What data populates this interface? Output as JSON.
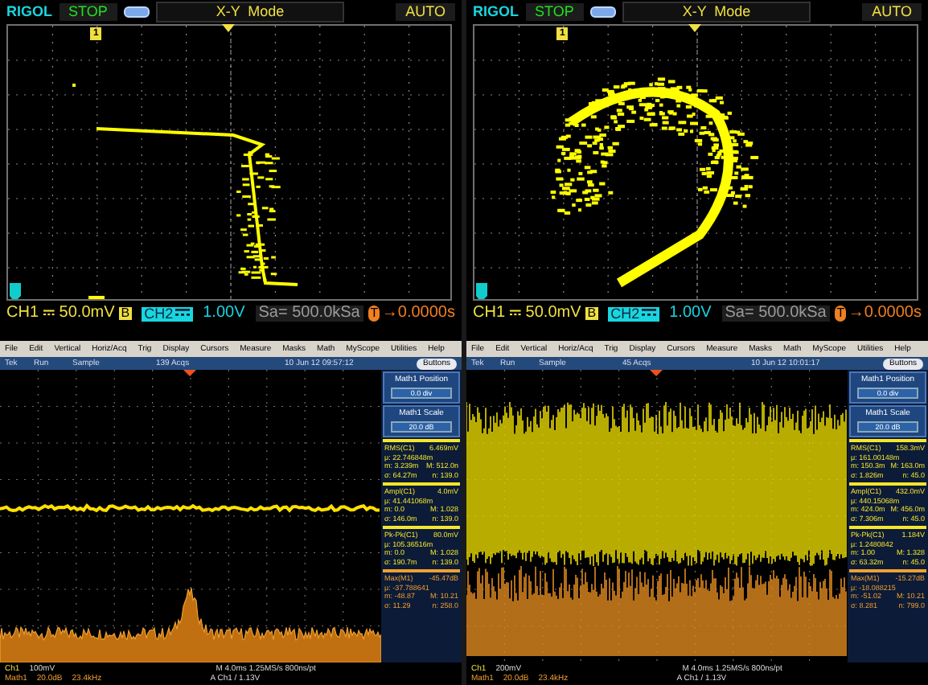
{
  "xy_scopes": [
    {
      "brand": "RIGOL",
      "run_state": "STOP",
      "mode": "X-Y  Mode",
      "trigger_mode": "AUTO",
      "trigger_marker": "1",
      "ch1": {
        "label": "CH1",
        "scale": "50.0mV",
        "badge": "B"
      },
      "ch2": {
        "label": "CH2",
        "scale": "1.00V"
      },
      "sample_rate": "Sa= 500.0kSa",
      "trigger_icon": "T",
      "trigger_offset": "→0.0000s",
      "kind": "trace"
    },
    {
      "brand": "RIGOL",
      "run_state": "STOP",
      "mode": "X-Y  Mode",
      "trigger_mode": "AUTO",
      "trigger_marker": "1",
      "ch1": {
        "label": "CH1",
        "scale": "50.0mV",
        "badge": "B"
      },
      "ch2": {
        "label": "CH2",
        "scale": "1.00V"
      },
      "sample_rate": "Sa= 500.0kSa",
      "trigger_icon": "T",
      "trigger_offset": "→0.0000s",
      "kind": "cloud"
    }
  ],
  "tek_scopes": [
    {
      "menu": [
        "File",
        "Edit",
        "Vertical",
        "Horiz/Acq",
        "Trig",
        "Display",
        "Cursors",
        "Measure",
        "Masks",
        "Math",
        "MyScope",
        "Utilities",
        "Help"
      ],
      "status": [
        "Tek",
        "Run",
        "Sample",
        "139 Acqs",
        "10 Jun 12 09:57:12"
      ],
      "buttons_label": "Buttons",
      "side_buttons": [
        {
          "title": "Math1 Position",
          "value": "0.0 div"
        },
        {
          "title": "Math1 Scale",
          "value": "20.0 dB"
        }
      ],
      "measurements": [
        {
          "name": "RMS(C1)",
          "value": "6.469mV",
          "color": "#f5e62a",
          "rows": [
            [
              "μ: 22.746848m"
            ],
            [
              "m: 3.239m",
              "M: 512.0n"
            ],
            [
              "σ: 64.27m",
              "n: 139.0"
            ]
          ]
        },
        {
          "name": "Ampl(C1)",
          "value": "4.0mV",
          "color": "#f5e62a",
          "rows": [
            [
              "μ: 41.441068m"
            ],
            [
              "m: 0.0",
              "M: 1.028"
            ],
            [
              "σ: 146.0m",
              "n: 139.0"
            ]
          ]
        },
        {
          "name": "Pk-Pk(C1)",
          "value": "80.0mV",
          "color": "#f5e62a",
          "rows": [
            [
              "μ: 105.36516m"
            ],
            [
              "m: 0.0",
              "M: 1.028"
            ],
            [
              "σ: 190.7m",
              "n: 139.0"
            ]
          ]
        },
        {
          "name": "Max(M1)",
          "value": "-45.47dB",
          "color": "#f0a030",
          "rows": [
            [
              "μ: -37.788641"
            ],
            [
              "m: -48.87",
              "M: 10.21"
            ],
            [
              "σ: 11.29",
              "n: 258.0"
            ]
          ]
        }
      ],
      "footer": {
        "ch": "Ch1",
        "ch_scale": "100mV",
        "timebase": "M 4.0ms 1.25MS/s 800ns/pt",
        "trigger": "A Ch1 / 1.13V",
        "math": "Math1",
        "math_scale": "20.0dB",
        "math_span": "23.4kHz"
      },
      "kind": "quiet"
    },
    {
      "menu": [
        "File",
        "Edit",
        "Vertical",
        "Horiz/Acq",
        "Trig",
        "Display",
        "Cursors",
        "Measure",
        "Masks",
        "Math",
        "MyScope",
        "Utilities",
        "Help"
      ],
      "status": [
        "Tek",
        "Run",
        "Sample",
        "45 Acqs",
        "10 Jun 12 10:01:17"
      ],
      "buttons_label": "Buttons",
      "side_buttons": [
        {
          "title": "Math1 Position",
          "value": "0.0 div"
        },
        {
          "title": "Math1 Scale",
          "value": "20.0 dB"
        }
      ],
      "measurements": [
        {
          "name": "RMS(C1)",
          "value": "158.3mV",
          "color": "#f5e62a",
          "rows": [
            [
              "μ: 161.00148m"
            ],
            [
              "m: 150.3m",
              "M: 163.0m"
            ],
            [
              "σ: 1.826m",
              "n: 45.0"
            ]
          ]
        },
        {
          "name": "Ampl(C1)",
          "value": "432.0mV",
          "color": "#f5e62a",
          "rows": [
            [
              "μ: 440.15068m"
            ],
            [
              "m: 424.0m",
              "M: 456.0m"
            ],
            [
              "σ: 7.306m",
              "n: 45.0"
            ]
          ]
        },
        {
          "name": "Pk-Pk(C1)",
          "value": "1.184V",
          "color": "#f5e62a",
          "rows": [
            [
              "μ: 1.2480842"
            ],
            [
              "m: 1.00",
              "M: 1.328"
            ],
            [
              "σ: 63.32m",
              "n: 45.0"
            ]
          ]
        },
        {
          "name": "Max(M1)",
          "value": "-15.27dB",
          "color": "#f0a030",
          "rows": [
            [
              "μ: -18.088215"
            ],
            [
              "m: -51.02",
              "M: 10.21"
            ],
            [
              "σ: 8.281",
              "n: 799.0"
            ]
          ]
        }
      ],
      "footer": {
        "ch": "Ch1",
        "ch_scale": "200mV",
        "timebase": "M 4.0ms 1.25MS/s 800ns/pt",
        "trigger": "A Ch1 / 1.13V",
        "math": "Math1",
        "math_scale": "20.0dB",
        "math_span": "23.4kHz"
      },
      "kind": "noisy"
    }
  ]
}
